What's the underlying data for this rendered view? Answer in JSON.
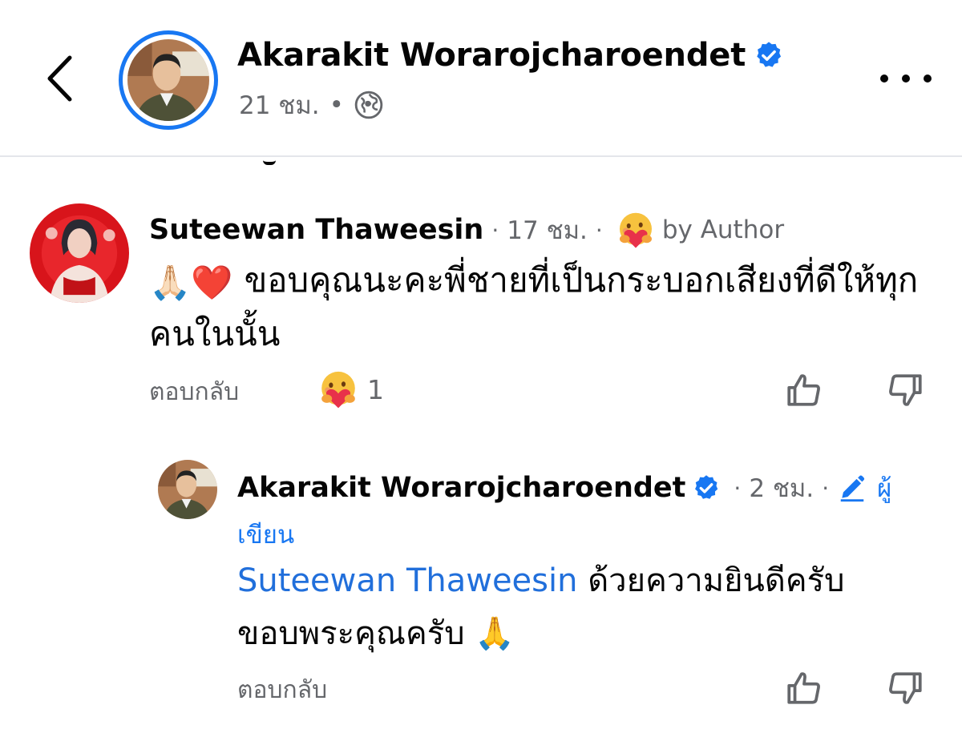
{
  "header": {
    "author_name": "Akarakit Worarojcharoendet",
    "time": "21 ชม.",
    "dot": "•",
    "privacy_icon": "globe-icon"
  },
  "comment": {
    "author_name": "Suteewan Thaweesin",
    "time": "17 ชม.",
    "sep1": "·",
    "sep2": "·",
    "sep3": "·",
    "author_reaction_label": "by Author",
    "body_emojis": "🙏🏻❤️",
    "body_text": "ขอบคุณนะคะพี่ชายที่เป็นกระบอกเสียงที่ดีให้ทุกคนในนั้น",
    "reply_label": "ตอบกลับ",
    "reaction_count": "1"
  },
  "reply": {
    "author_name": "Akarakit Worarojcharoendet",
    "time": "2 ชม.",
    "sep1": "·",
    "sep2": "·",
    "author_badge_1": "ผู้",
    "author_badge_2": "เขียน",
    "mention": "Suteewan Thaweesin",
    "body_line1": " ด้วยความยินดีครับ",
    "body_line2": "ขอบพระคุณครับ ",
    "body_emoji": "🙏",
    "reply_label": "ตอบกลับ"
  },
  "colors": {
    "accent": "#1877f2",
    "mention": "#216fdb",
    "secondary_text": "#65676b",
    "primary_text": "#050505",
    "divider": "#e4e6eb"
  }
}
